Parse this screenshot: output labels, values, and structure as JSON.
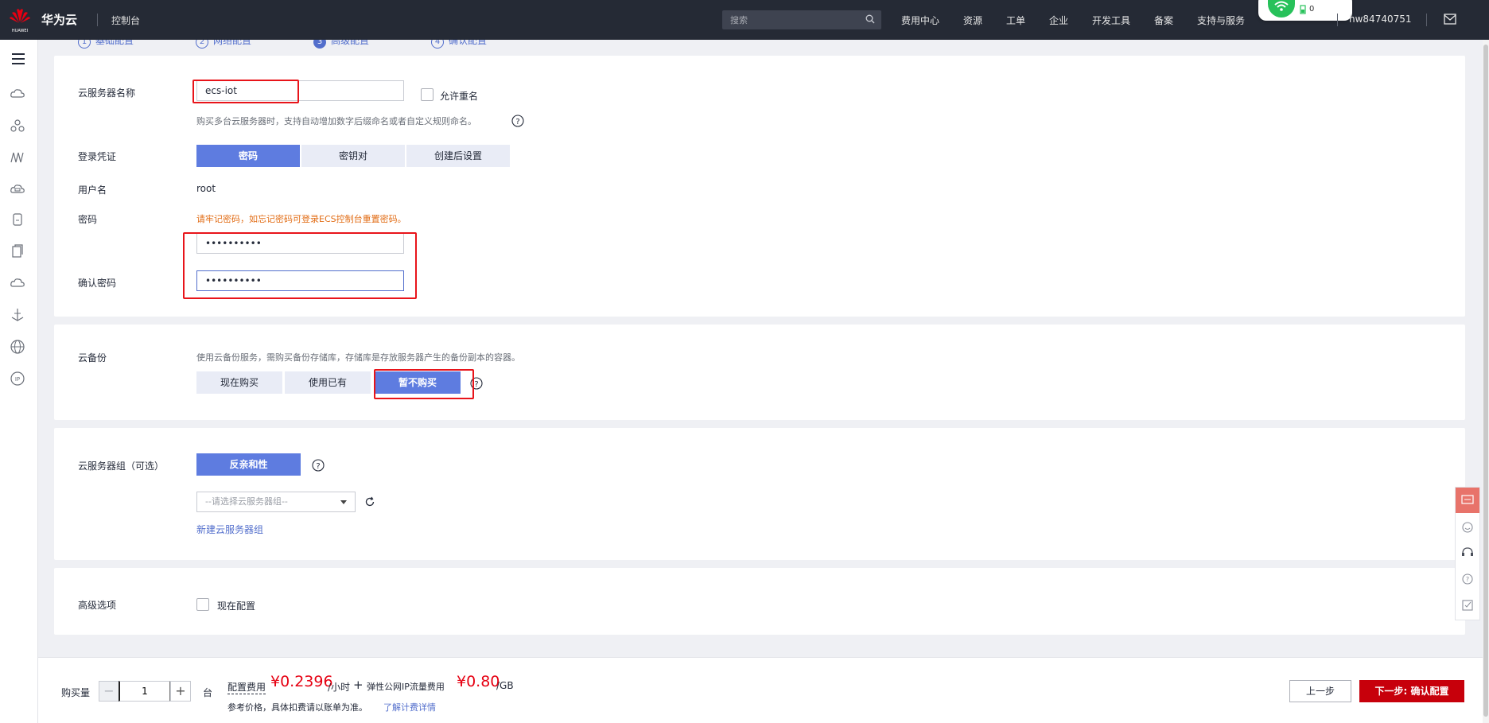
{
  "header": {
    "brand": "华为云",
    "logo_caption": "HUAWEI",
    "console": "控制台",
    "search_placeholder": "搜索",
    "nav": [
      "费用中心",
      "资源",
      "工单",
      "企业",
      "开发工具",
      "备案",
      "支持与服务"
    ],
    "username": "hw84740751",
    "wifi_count": "0"
  },
  "steps": [
    "基础配置",
    "网络配置",
    "高级配置",
    "确认配置"
  ],
  "server_name": {
    "label": "云服务器名称",
    "value": "ecs-iot",
    "allow_dup_label": "允许重名",
    "hint": "购买多台云服务器时，支持自动增加数字后缀命名或者自定义规则命名。"
  },
  "login": {
    "label": "登录凭证",
    "options": [
      "密码",
      "密钥对",
      "创建后设置"
    ],
    "selected": "密码"
  },
  "username_row": {
    "label": "用户名",
    "value": "root"
  },
  "password": {
    "label": "密码",
    "warning": "请牢记密码，如忘记密码可登录ECS控制台重置密码。",
    "value": "••••••••••"
  },
  "confirm_password": {
    "label": "确认密码",
    "value": "••••••••••"
  },
  "backup": {
    "label": "云备份",
    "hint": "使用云备份服务，需购买备份存储库，存储库是存放服务器产生的备份副本的容器。",
    "options": [
      "现在购买",
      "使用已有",
      "暂不购买"
    ],
    "selected": "暂不购买"
  },
  "server_group": {
    "label": "云服务器组（可选）",
    "affinity": "反亲和性",
    "select_placeholder": "--请选择云服务器组--",
    "create_link": "新建云服务器组"
  },
  "advanced": {
    "label": "高级选项",
    "option": "现在配置"
  },
  "footer": {
    "qty_label": "购买量",
    "qty_value": "1",
    "qty_unit": "台",
    "config_fee_label": "配置费用",
    "config_fee": "¥0.2396",
    "config_fee_unit": "/小时",
    "plus": "+",
    "eip_label": "弹性公网IP流量费用",
    "eip_fee": "¥0.80",
    "eip_unit": "/GB",
    "note": "参考价格，具体扣费请以账单为准。",
    "detail_link": "了解计费详情",
    "prev": "上一步",
    "next": "下一步: 确认配置"
  }
}
